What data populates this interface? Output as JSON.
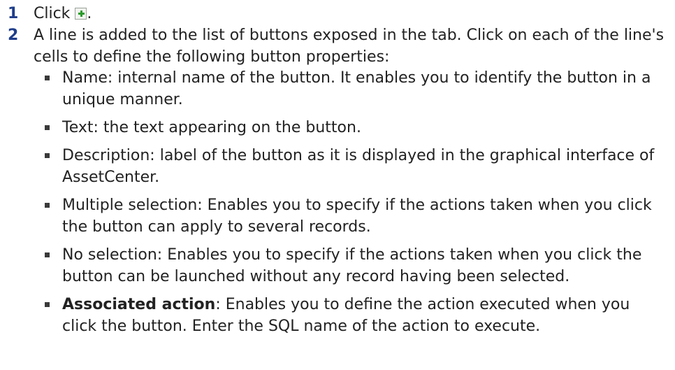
{
  "steps": [
    {
      "number": "1",
      "text_before": "Click ",
      "text_after": "."
    },
    {
      "number": "2",
      "text": "A line is added to the list of buttons exposed in the tab. Click on each of the line's cells to define the following button properties:"
    }
  ],
  "bullets": [
    {
      "term": "",
      "text": "Name: internal name of the button. It enables you to identify the button in a unique manner."
    },
    {
      "term": "",
      "text": "Text: the text appearing on the button."
    },
    {
      "term": "",
      "text": "Description: label of the button as it is displayed in the graphical interface of AssetCenter."
    },
    {
      "term": "",
      "text": "Multiple selection: Enables you to specify if the actions taken when you click the button can apply to several records."
    },
    {
      "term": "",
      "text": "No selection: Enables you to specify if the actions taken when you click the button can be launched without any record having been selected."
    },
    {
      "term": "Associated action",
      "text": ": Enables you to define the action executed when you click the button. Enter the SQL name of the action to execute."
    }
  ],
  "icons": {
    "add": "add-icon"
  },
  "colors": {
    "step_number": "#1f3d8a",
    "text": "#222222",
    "icon_plus": "#2a9a2a"
  }
}
